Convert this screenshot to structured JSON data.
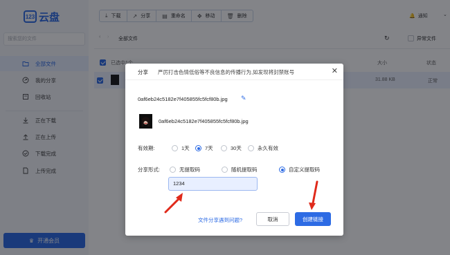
{
  "app": {
    "logo_mark": "123",
    "logo_text": "云盘",
    "search_placeholder": "搜索您的文件",
    "nav": [
      {
        "label": "全部文件",
        "icon": "folder-icon"
      },
      {
        "label": "我的分享",
        "icon": "share-icon"
      },
      {
        "label": "回收站",
        "icon": "trash-icon"
      },
      {
        "label": "正在下载",
        "icon": "download-icon"
      },
      {
        "label": "正在上传",
        "icon": "upload-icon"
      },
      {
        "label": "下载完成",
        "icon": "check-circle-icon"
      },
      {
        "label": "上传完成",
        "icon": "document-icon"
      }
    ],
    "vip_label": "开通会员",
    "toolbar": [
      "下载",
      "分享",
      "重命名",
      "移动",
      "删除"
    ],
    "notify_label": "通知",
    "breadcrumb": "全部文件",
    "abnormal_label": "异常文件",
    "list_head": {
      "selected": "已选中1个",
      "size": "大小",
      "status": "状态"
    },
    "row": {
      "size": "31.88 KB",
      "status": "正常"
    }
  },
  "dialog": {
    "title": "分享",
    "notice": "严厉打击色情低俗等不良信息的传播行为,如发现将封禁账号",
    "filename": "0af6eb24c5182e7f405855fc5fcf80b.jpg",
    "filename_thumb": "0af6eb24c5182e7f405855fc5fcf80b.jpg",
    "validity_label": "有效期:",
    "validity_options": [
      "1天",
      "7天",
      "30天",
      "永久有效"
    ],
    "validity_selected": 1,
    "mode_label": "分享形式:",
    "mode_options": [
      "无提取码",
      "随机提取码",
      "自定义提取码"
    ],
    "mode_selected": 2,
    "code_value": "1234",
    "help_link": "文件分享遇到问题?",
    "cancel_label": "取消",
    "create_label": "创建链接"
  },
  "colors": {
    "accent": "#2d6be4",
    "arrow": "#e02a1b"
  }
}
